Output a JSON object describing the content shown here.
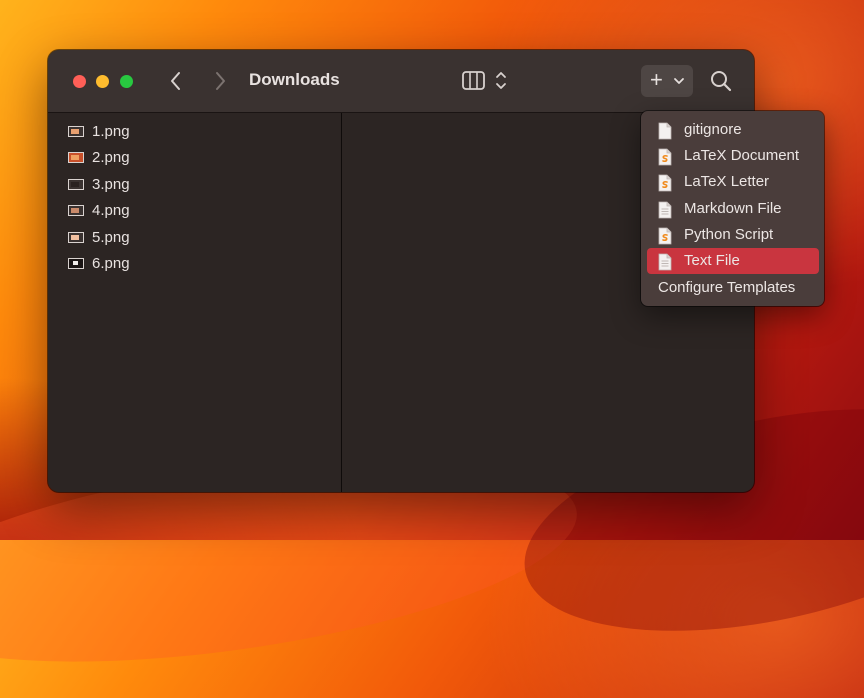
{
  "window": {
    "title": "Downloads"
  },
  "files": [
    {
      "name": "1.png"
    },
    {
      "name": "2.png"
    },
    {
      "name": "3.png"
    },
    {
      "name": "4.png"
    },
    {
      "name": "5.png"
    },
    {
      "name": "6.png"
    }
  ],
  "toolbar": {
    "new_button": "+"
  },
  "new_menu": {
    "items": [
      {
        "label": "gitignore",
        "icon": "document-icon"
      },
      {
        "label": "LaTeX Document",
        "icon": "latex-document-icon"
      },
      {
        "label": "LaTeX Letter",
        "icon": "latex-document-icon"
      },
      {
        "label": "Markdown File",
        "icon": "document-icon"
      },
      {
        "label": "Python Script",
        "icon": "script-document-icon"
      },
      {
        "label": "Text File",
        "icon": "document-icon",
        "selected": true
      }
    ],
    "configure_label": "Configure Templates"
  },
  "colors": {
    "accent": "#c9353f",
    "window_bg": "#2c2523",
    "toolbar_bg": "#3a3230",
    "menu_bg": "#4a3d3b"
  }
}
